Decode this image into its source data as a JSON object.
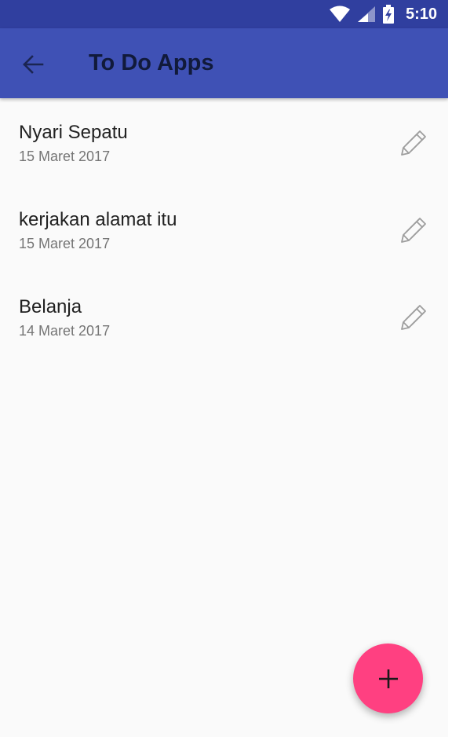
{
  "status_bar": {
    "time": "5:10",
    "icons": [
      "wifi-icon",
      "cell-signal-icon",
      "battery-charging-icon"
    ],
    "background": "#303f9f"
  },
  "app_bar": {
    "title": "To Do Apps",
    "back_icon": "arrow-back-icon",
    "background": "#3f51b5"
  },
  "todos": [
    {
      "title": "Nyari Sepatu",
      "date": "15 Maret 2017",
      "action_icon": "pencil-icon"
    },
    {
      "title": "kerjakan alamat itu",
      "date": "15 Maret 2017",
      "action_icon": "pencil-icon"
    },
    {
      "title": "Belanja",
      "date": "14 Maret 2017",
      "action_icon": "pencil-icon"
    }
  ],
  "fab": {
    "icon": "plus-icon",
    "color": "#ff4081"
  }
}
